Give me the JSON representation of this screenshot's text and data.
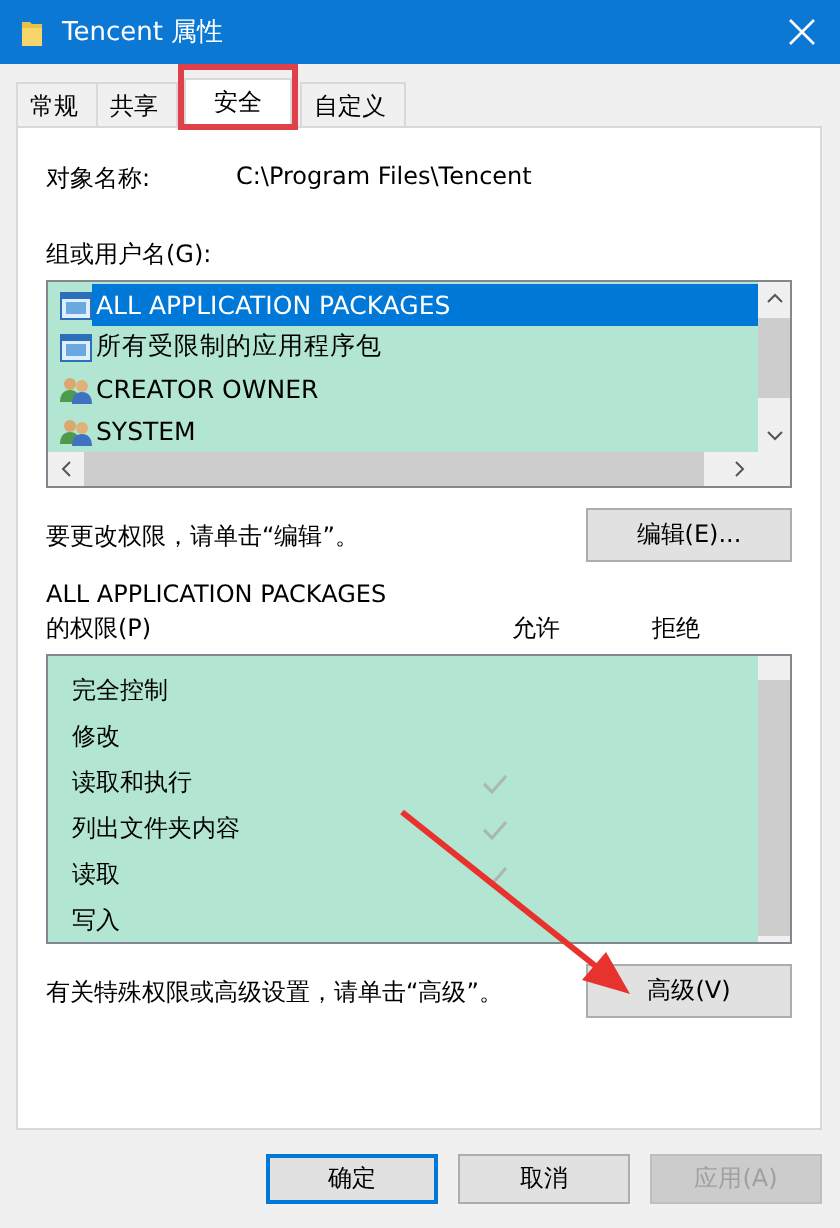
{
  "window": {
    "title": "Tencent 属性"
  },
  "tabs": [
    {
      "label": "常规",
      "selected": false,
      "highlighted": false
    },
    {
      "label": "共享",
      "selected": false,
      "highlighted": false
    },
    {
      "label": "安全",
      "selected": true,
      "highlighted": true
    },
    {
      "label": "自定义",
      "selected": false,
      "highlighted": false
    }
  ],
  "object_name": {
    "label": "对象名称:",
    "value": "C:\\Program Files\\Tencent"
  },
  "users": {
    "label": "组或用户名(G):",
    "items": [
      {
        "name": "ALL APPLICATION PACKAGES",
        "kind": "package",
        "selected": true
      },
      {
        "name": "所有受限制的应用程序包",
        "kind": "package",
        "selected": false
      },
      {
        "name": "CREATOR OWNER",
        "kind": "group",
        "selected": false
      },
      {
        "name": "SYSTEM",
        "kind": "group",
        "selected": false
      }
    ]
  },
  "edit_hint": "要更改权限，请单击“编辑”。",
  "edit_button": "编辑(E)...",
  "permissions": {
    "subject": "ALL APPLICATION PACKAGES",
    "label": "的权限(P)",
    "allow_header": "允许",
    "deny_header": "拒绝",
    "items": [
      {
        "name": "完全控制",
        "allow": false,
        "deny": false
      },
      {
        "name": "修改",
        "allow": false,
        "deny": false
      },
      {
        "name": "读取和执行",
        "allow": true,
        "deny": false
      },
      {
        "name": "列出文件夹内容",
        "allow": true,
        "deny": false
      },
      {
        "name": "读取",
        "allow": true,
        "deny": false
      },
      {
        "name": "写入",
        "allow": false,
        "deny": false
      }
    ]
  },
  "advanced_hint": "有关特殊权限或高级设置，请单击“高级”。",
  "advanced_button": {
    "label": "高级(V)",
    "pointed_at": true
  },
  "buttons": [
    {
      "label": "确定",
      "default": true,
      "disabled": false
    },
    {
      "label": "取消",
      "default": false,
      "disabled": false
    },
    {
      "label": "应用(A)",
      "default": false,
      "disabled": true
    }
  ]
}
